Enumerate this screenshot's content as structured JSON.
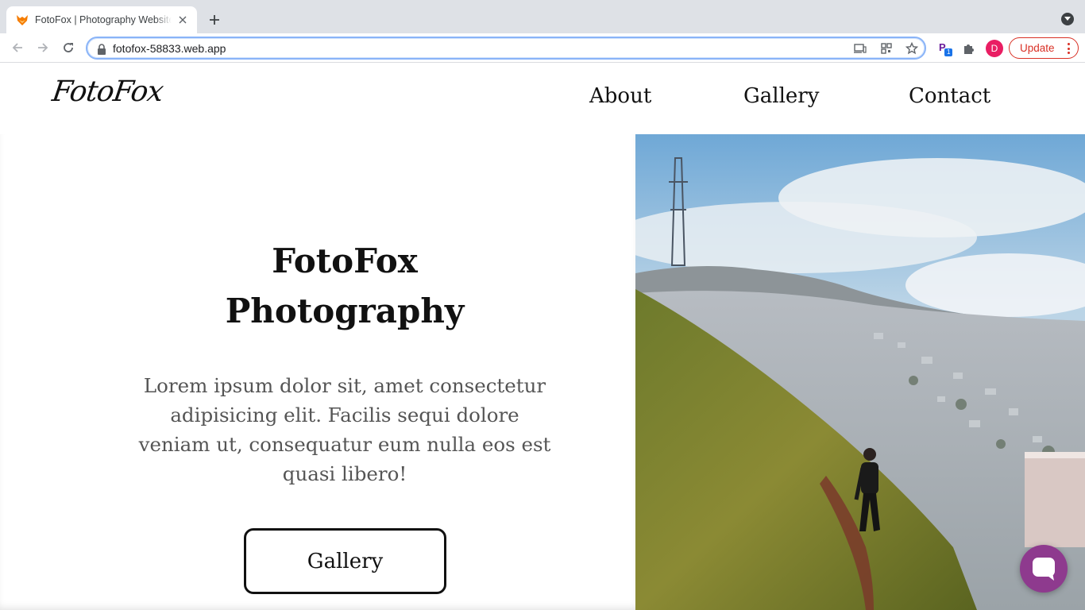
{
  "browser": {
    "tab_title": "FotoFox | Photography Website",
    "url": "fotofox-58833.web.app",
    "extension_badge": "1",
    "profile_initial": "D",
    "update_label": "Update"
  },
  "site": {
    "logo": "FotoFox",
    "nav": [
      "About",
      "Gallery",
      "Contact"
    ]
  },
  "hero": {
    "title_line1": "FotoFox",
    "title_line2": "Photography",
    "description": "Lorem ipsum dolor sit, amet consectetur adipisicing elit. Facilis sequi dolore veniam ut, consequatur eum nulla eos est quasi libero!",
    "button_label": "Gallery"
  },
  "colors": {
    "accent_chat": "#8e3a8e",
    "update_red": "#d93025",
    "omnibox_focus": "#8ab4f8"
  },
  "icons": [
    "fox-favicon-icon",
    "close-icon",
    "plus-icon",
    "tab-search-icon",
    "back-arrow-icon",
    "forward-arrow-icon",
    "reload-icon",
    "lock-icon",
    "cast-icon",
    "qr-code-icon",
    "star-icon",
    "extension-icon",
    "puzzle-icon",
    "more-vert-icon",
    "chat-icon"
  ]
}
